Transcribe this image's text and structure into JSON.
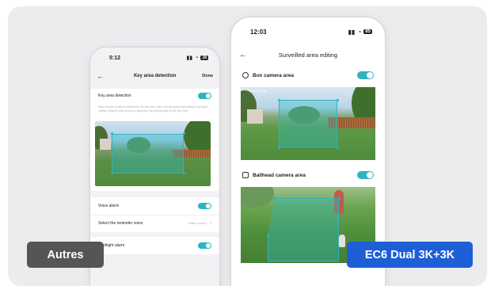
{
  "left_phone": {
    "time": "5:12",
    "battery": "28",
    "nav": {
      "back": "←",
      "title": "Key area detection",
      "done": "Done"
    },
    "detection_label": "Key area detection",
    "description": "When human motion is detected in the key area, alarm will be pushed according to the alarm setting. Drag the dots around to adjust the size and position of the key area.",
    "voice_alarm_label": "Voice alarm",
    "reminder_label": "Select the reminder voice",
    "reminder_value": "Alarm sound",
    "spotlight_label": "Spotlight alarm"
  },
  "right_phone": {
    "time": "12:03",
    "battery": "85",
    "nav": {
      "back": "←",
      "title": "Surveilled area editing"
    },
    "box_label": "Box camera area",
    "ballhead_label": "Ballhead camera area",
    "box_watermark": "2024.03.22 14:25:18"
  },
  "tags": {
    "left": "Autres",
    "right": "EC6 Dual 3K+3K"
  },
  "colors": {
    "accent": "#2fb3c0",
    "left_tag": "#555555",
    "right_tag": "#1e5fd6"
  }
}
